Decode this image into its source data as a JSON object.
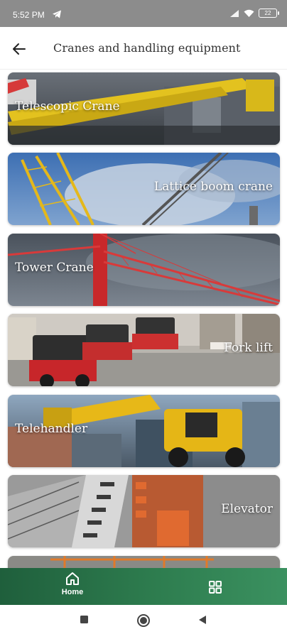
{
  "status_bar": {
    "time": "5:52 PM",
    "battery": "22"
  },
  "header": {
    "title": "Cranes and handling equipment"
  },
  "cards": [
    {
      "label": "Telescopic Crane"
    },
    {
      "label": "Lattice boom crane"
    },
    {
      "label": "Tower Crane"
    },
    {
      "label": "Fork lift"
    },
    {
      "label": "Telehandler"
    },
    {
      "label": "Elevator"
    }
  ],
  "bottom_nav": {
    "home_label": "Home"
  },
  "colors": {
    "nav_green": "#2e7d4f",
    "status_bar": "#8c8c8c"
  }
}
